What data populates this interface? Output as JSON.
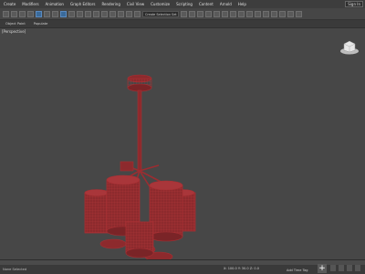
{
  "menu": {
    "items": [
      "Create",
      "Modifiers",
      "Animation",
      "Graph Editors",
      "Rendering",
      "Civil View",
      "Customize",
      "Scripting",
      "Content",
      "Arnold",
      "Help"
    ],
    "sign_in": "Sign In"
  },
  "toolbar": {
    "selection_set": "Create Selection Set"
  },
  "ribbon_tabs": [
    "Object Paint",
    "Populate"
  ],
  "viewport": {
    "label": "[Perspective]"
  },
  "status": {
    "selection": "None Selected",
    "coords": "X: 100.0  Y: 30.0  Z: 0.0",
    "grid": "Grid = 10.0cm",
    "add_time_tag": "Add Time Tag"
  },
  "colors": {
    "model_wire": "#a62f33",
    "model_fill": "#8d2a2d",
    "viewport_bg": "#474747"
  }
}
